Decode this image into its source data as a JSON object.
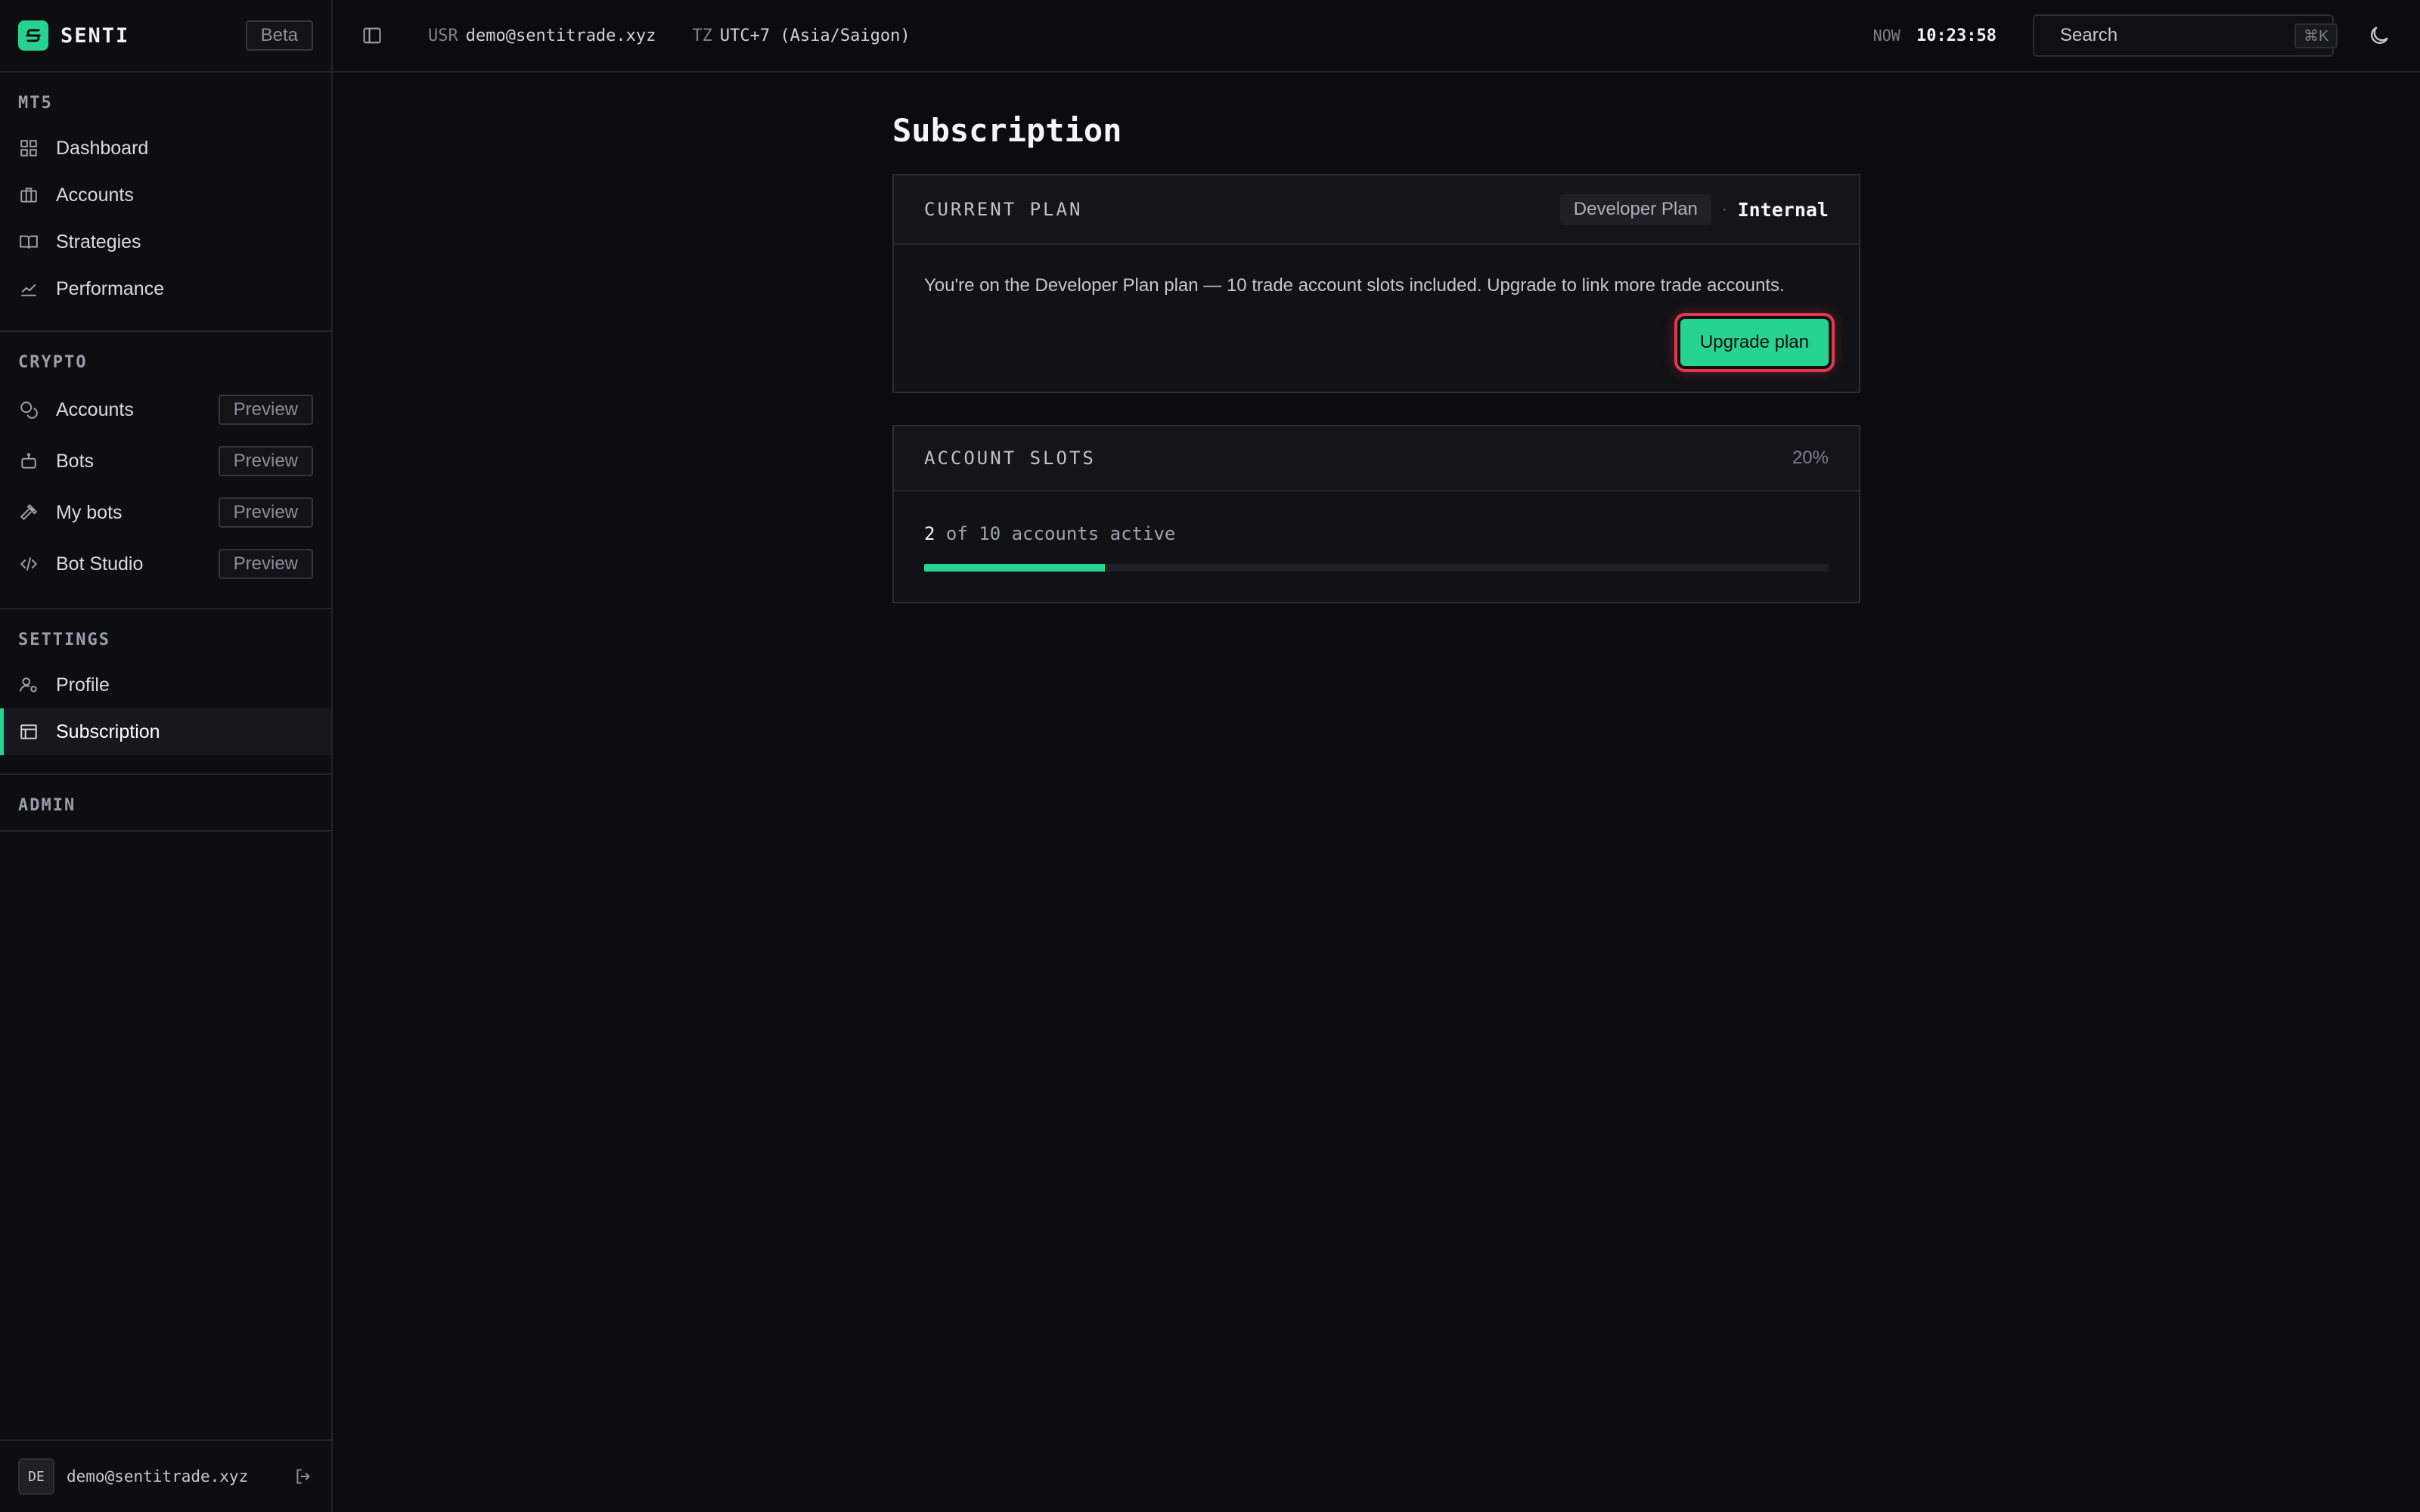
{
  "brand": {
    "name": "SENTI",
    "badge": "Beta"
  },
  "topbar": {
    "user_key": "USR",
    "user_value": "demo@sentitrade.xyz",
    "tz_key": "TZ",
    "tz_value": "UTC+7 (Asia/Saigon)",
    "now_key": "NOW",
    "now_value": "10:23:58",
    "search_placeholder": "Search",
    "search_shortcut": "⌘K"
  },
  "sidebar": {
    "mt5": {
      "heading": "MT5",
      "items": [
        {
          "label": "Dashboard",
          "icon": "grid-icon"
        },
        {
          "label": "Accounts",
          "icon": "briefcase-icon"
        },
        {
          "label": "Strategies",
          "icon": "book-icon"
        },
        {
          "label": "Performance",
          "icon": "chart-line-icon"
        }
      ]
    },
    "crypto": {
      "heading": "CRYPTO",
      "items": [
        {
          "label": "Accounts",
          "badge": "Preview",
          "icon": "coins-icon"
        },
        {
          "label": "Bots",
          "badge": "Preview",
          "icon": "bot-icon"
        },
        {
          "label": "My bots",
          "badge": "Preview",
          "icon": "hammer-icon"
        },
        {
          "label": "Bot Studio",
          "badge": "Preview",
          "icon": "code-icon"
        }
      ]
    },
    "settings": {
      "heading": "SETTINGS",
      "items": [
        {
          "label": "Profile",
          "icon": "user-gear-icon"
        },
        {
          "label": "Subscription",
          "icon": "card-icon",
          "active": true
        }
      ]
    },
    "admin": {
      "heading": "ADMIN"
    },
    "footer": {
      "avatar": "DE",
      "email": "demo@sentitrade.xyz"
    }
  },
  "main": {
    "title": "Subscription",
    "current_plan": {
      "heading": "CURRENT PLAN",
      "plan_name": "Developer Plan",
      "separator": "·",
      "tag": "Internal",
      "description": "You're on the Developer Plan plan — 10 trade account slots included. Upgrade to link more trade accounts.",
      "button": "Upgrade plan"
    },
    "account_slots": {
      "heading": "ACCOUNT SLOTS",
      "percent_label": "20%",
      "active_count": "2",
      "of_text": "of 10 accounts active",
      "progress": 0.2
    }
  },
  "colors": {
    "accent": "#27d391",
    "focus_ring": "#e0384f",
    "background": "#0b0c0f"
  }
}
